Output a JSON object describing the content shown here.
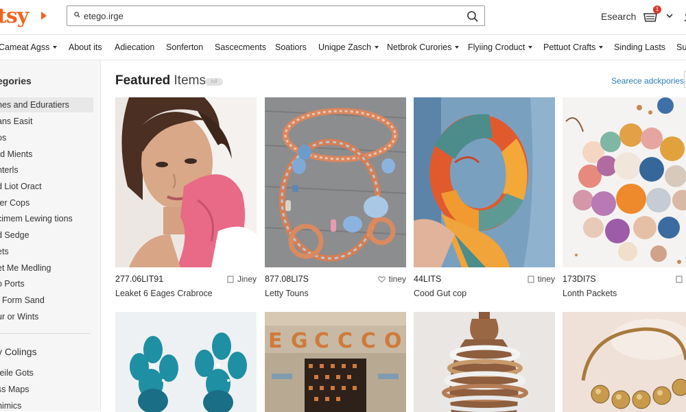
{
  "header": {
    "logo": "tsy",
    "search_value": "etego.irge",
    "right_link": "Esearch",
    "cart_count": "1"
  },
  "nav": {
    "items": [
      {
        "label": "Cameat Agss",
        "chevron": true
      },
      {
        "label": "About its"
      },
      {
        "label": "Adiecation"
      },
      {
        "label": "Sonferton"
      },
      {
        "label": "Sascecments"
      },
      {
        "label": "Soatiors"
      },
      {
        "label": "Uniqpe Zasch",
        "chevron": true
      },
      {
        "label": "Netbrok Curories",
        "chevron": true
      },
      {
        "label": "Flyiing Croduct",
        "chevron": true
      },
      {
        "label": "Pettuot Crafts",
        "chevron": true
      },
      {
        "label": "Sinding Lasts"
      },
      {
        "label": "Su"
      }
    ]
  },
  "sidebar": {
    "title": "egories",
    "items": [
      "nes and Eduratiers",
      "ans Easit",
      "os",
      "rd Mients",
      "nterls",
      "d Liot Oract",
      "ter Cops",
      "cimem Lewing tions",
      "d Sedge",
      "ets",
      "et Me Medling",
      "o Ports",
      "t Form Sand",
      "ur or Wints"
    ],
    "title2": "y Colings",
    "items2": [
      "feile Gots",
      "ss Maps",
      "nimics"
    ]
  },
  "main": {
    "title_bold": "Featured",
    "title_rest": "Items",
    "pill": "full",
    "see_more": "Searece adckpories",
    "products": [
      {
        "price": "277.06LIT91",
        "shop": "Jiney",
        "shop_icon": "bookmark-icon",
        "name": "Leaket 6 Eages Crabroce"
      },
      {
        "price": "877.08LI7S",
        "shop": "tiney",
        "shop_icon": "heart-icon",
        "name": "Letty Touns"
      },
      {
        "price": "44LITS",
        "shop": "tiney",
        "shop_icon": "bookmark-icon",
        "name": "Cood Gut cop"
      },
      {
        "price": "173DI7S",
        "shop": "",
        "shop_icon": "bookmark-icon",
        "name": "Lonth Packets"
      }
    ]
  },
  "colors": {
    "brand": "#f1641e",
    "link": "#2c7bb6",
    "badge": "#d93a2b"
  }
}
